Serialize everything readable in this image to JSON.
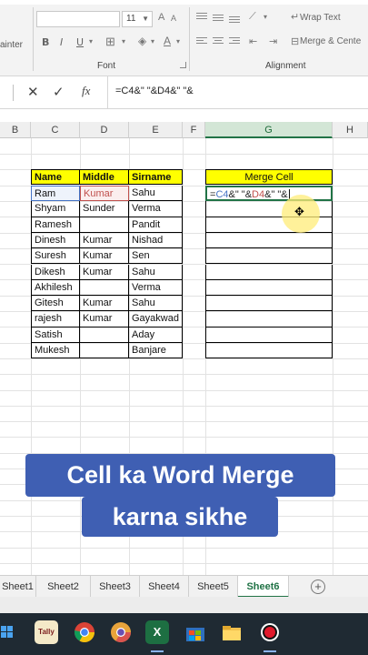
{
  "ribbon": {
    "font_painter_partial": "ainter",
    "font_size": "11",
    "bold": "B",
    "italic": "I",
    "underline": "U",
    "group_font": "Font",
    "group_alignment": "Alignment",
    "wrap_text": "Wrap Text",
    "merge_center": "Merge & Cente"
  },
  "formula_bar": {
    "cancel_glyph": "✕",
    "enter_glyph": "✓",
    "fx_label": "fx",
    "formula": "=C4&\" \"&D4&\" \"&"
  },
  "columns": [
    "B",
    "C",
    "D",
    "E",
    "F",
    "G",
    "H"
  ],
  "active_column": "G",
  "table": {
    "headers": [
      "Name",
      "Middle",
      "Sirname"
    ],
    "rows": [
      [
        "Ram",
        "Kumar",
        "Sahu"
      ],
      [
        "Shyam",
        "Sunder",
        "Verma"
      ],
      [
        "Ramesh",
        "",
        "Pandit"
      ],
      [
        "Dinesh",
        "Kumar",
        "Nishad"
      ],
      [
        "Suresh",
        "Kumar",
        "Sen"
      ],
      [
        "Dikesh",
        "Kumar",
        "Sahu"
      ],
      [
        "Akhilesh",
        "",
        "Verma"
      ],
      [
        "Gitesh",
        "Kumar",
        "Sahu"
      ],
      [
        "rajesh",
        "Kumar",
        "Gayakwad"
      ],
      [
        "Satish",
        "",
        "Aday"
      ],
      [
        "Mukesh",
        "",
        "Banjare"
      ]
    ]
  },
  "merge": {
    "header": "Merge Cell",
    "edit_prefix": "=",
    "edit_c4": "C4",
    "edit_mid": "&\" \"&",
    "edit_d4": "D4",
    "edit_suffix": "&\" \"&"
  },
  "banner": {
    "line1": "Cell ka Word Merge",
    "line2": "karna sikhe"
  },
  "sheets": [
    "Sheet1",
    "Sheet2",
    "Sheet3",
    "Sheet4",
    "Sheet5",
    "Sheet6"
  ],
  "active_sheet": "Sheet6",
  "add_sheet_glyph": "+",
  "taskbar": {
    "apps": [
      "start-icon",
      "tally-icon",
      "chrome-icon",
      "chrome-canary-icon",
      "excel-icon",
      "windows-store-icon",
      "file-explorer-icon",
      "screen-recorder-icon"
    ],
    "tally_text": "Tally",
    "excel_text": "X"
  },
  "colors": {
    "excel_green": "#217346",
    "header_yellow": "#ffff00",
    "banner_blue": "#3f5fb3",
    "ref_blue": "#4472c4",
    "ref_red": "#c0504d"
  }
}
